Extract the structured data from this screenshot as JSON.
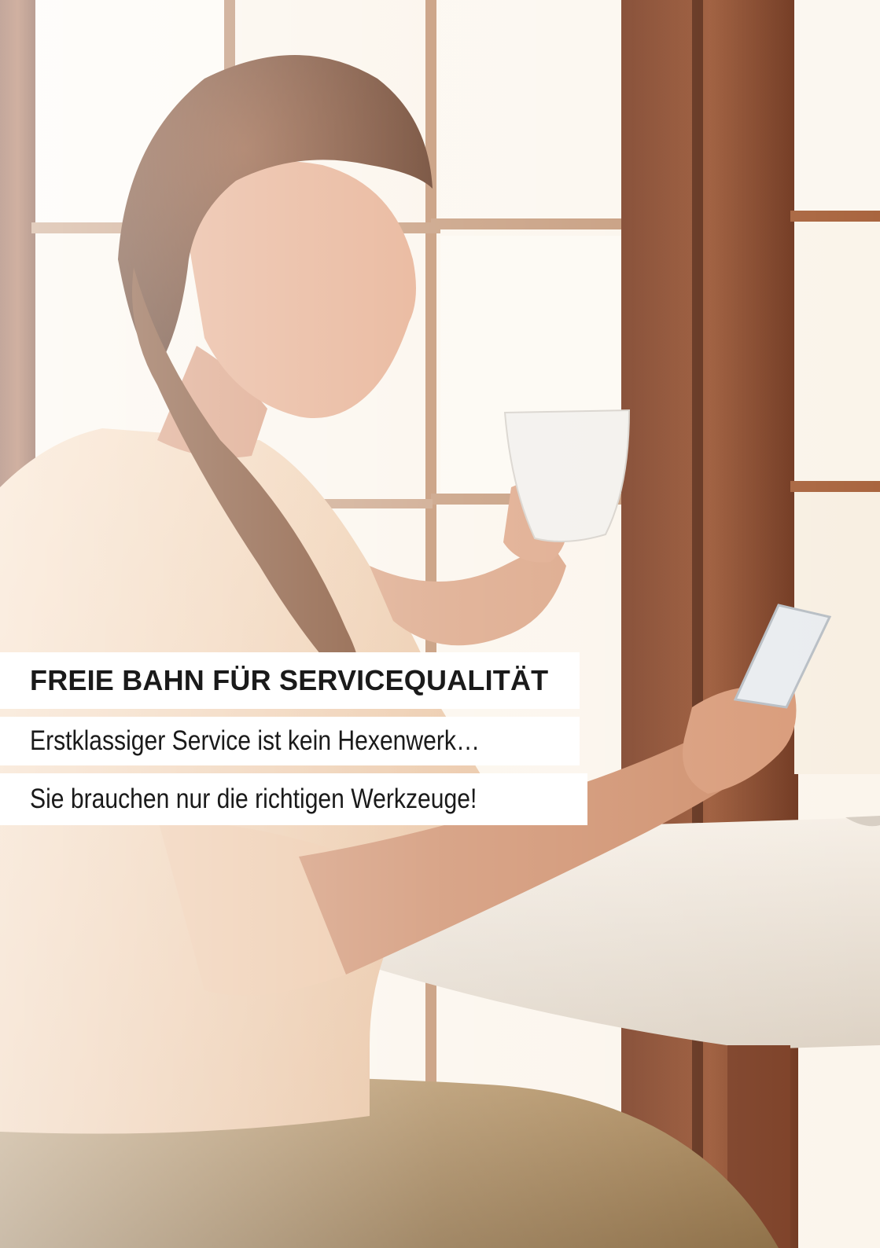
{
  "poster": {
    "headline": "FREIE BAHN FÜR SERVICEQUALITÄT",
    "tagline_1": "Erstklassiger Service ist kein Hexenwerk…",
    "tagline_2": "Sie brauchen nur die richtigen Werkzeuge!"
  },
  "colors": {
    "window_frame": "#8a4a2c",
    "window_light": "#fbf6ee",
    "blouse": "#f1d2b4",
    "trousers": "#a98656",
    "hair": "#6a3a22",
    "skin": "#e3a888",
    "caption_bg": "#ffffff",
    "caption_text": "#1a1a1a"
  }
}
